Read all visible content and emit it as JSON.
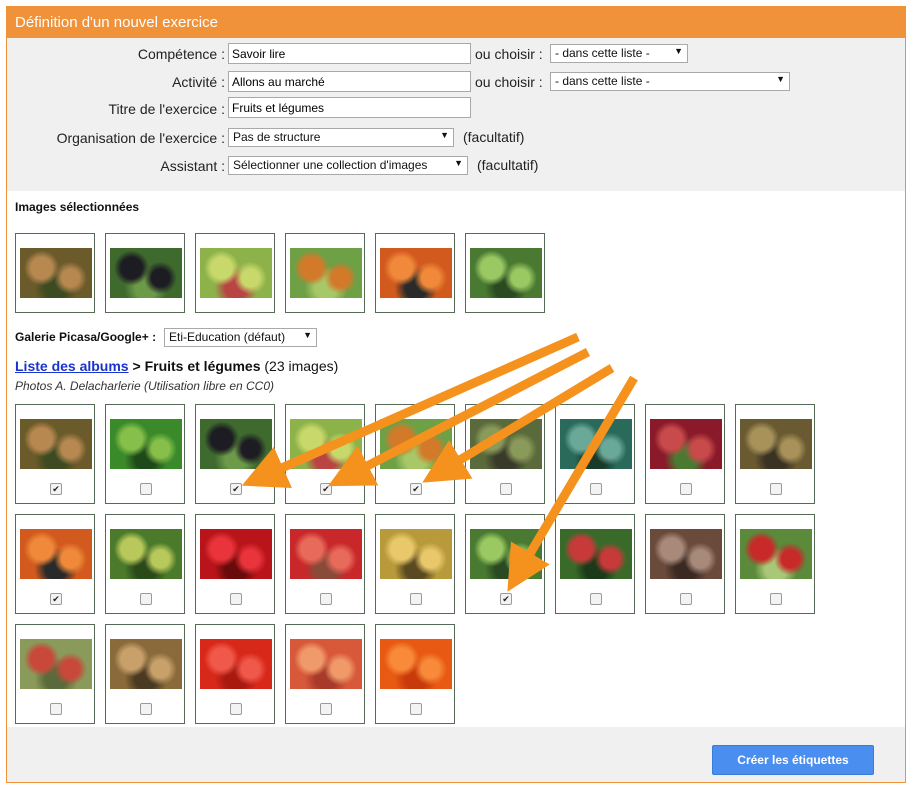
{
  "header": {
    "title": "Définition d'un nouvel exercice"
  },
  "form": {
    "competence": {
      "label": "Compétence :",
      "value": "Savoir lire",
      "or_label": "ou choisir :",
      "select": "- dans cette liste -"
    },
    "activite": {
      "label": "Activité :",
      "value": "Allons au marché",
      "or_label": "ou choisir :",
      "select": "- dans cette liste -"
    },
    "titre": {
      "label": "Titre de l'exercice :",
      "value": "Fruits et légumes"
    },
    "organisation": {
      "label": "Organisation de l'exercice :",
      "select": "Pas de structure",
      "note": "(facultatif)"
    },
    "assistant": {
      "label": "Assistant :",
      "select": "Sélectionner une collection d'images",
      "note": "(facultatif)"
    }
  },
  "selected": {
    "title": "Images sélectionnées",
    "images": [
      {
        "name": "raisins",
        "colors": [
          "#6b5a2a",
          "#b78850",
          "#3d4a22"
        ]
      },
      {
        "name": "mures",
        "colors": [
          "#3e6a2e",
          "#1c1c22",
          "#6c9a48"
        ]
      },
      {
        "name": "raisins-verts",
        "colors": [
          "#8db24a",
          "#c8d86a",
          "#b84444"
        ]
      },
      {
        "name": "tomates-vertes",
        "colors": [
          "#6ea046",
          "#d27a2a",
          "#a8c868"
        ]
      },
      {
        "name": "potiron",
        "colors": [
          "#d25a1e",
          "#f08a3a",
          "#2a2a2a"
        ]
      },
      {
        "name": "salade",
        "colors": [
          "#4a7a32",
          "#9ac862",
          "#2a4a22"
        ]
      }
    ]
  },
  "gallery": {
    "label": "Galerie Picasa/Google+ :",
    "select": "Eti-Education (défaut)"
  },
  "album": {
    "link": "Liste des albums",
    "separator": ">",
    "name": "Fruits et légumes",
    "count": "(23 images)",
    "credit": "Photos A. Delacharlerie (Utilisation libre en CC0)"
  },
  "album_images": [
    {
      "name": "raisins",
      "checked": true,
      "colors": [
        "#6b5a2a",
        "#b78850",
        "#3d4a22"
      ]
    },
    {
      "name": "poivrons",
      "checked": false,
      "colors": [
        "#3a8a2a",
        "#86c04a",
        "#1e4a1a"
      ]
    },
    {
      "name": "mures",
      "checked": true,
      "colors": [
        "#3e6a2e",
        "#1c1c22",
        "#6c9a48"
      ]
    },
    {
      "name": "raisins-verts",
      "checked": true,
      "colors": [
        "#8db24a",
        "#c8d86a",
        "#b84444"
      ]
    },
    {
      "name": "tomates-vertes",
      "checked": true,
      "colors": [
        "#6ea046",
        "#d27a2a",
        "#a8c868"
      ]
    },
    {
      "name": "legumes-jardin",
      "checked": false,
      "colors": [
        "#5a6a3a",
        "#8a9a5a",
        "#3a3a2a"
      ]
    },
    {
      "name": "chou",
      "checked": false,
      "colors": [
        "#2a6a5a",
        "#6aa898",
        "#1a3a2a"
      ]
    },
    {
      "name": "cerises",
      "checked": false,
      "colors": [
        "#8a1a2a",
        "#c84a4a",
        "#4a7a32"
      ]
    },
    {
      "name": "pommes-de-terre",
      "checked": false,
      "colors": [
        "#6a5a32",
        "#a8925a",
        "#3a3222"
      ]
    },
    {
      "name": "potiron",
      "checked": true,
      "colors": [
        "#d25a1e",
        "#f08a3a",
        "#2a2a2a"
      ]
    },
    {
      "name": "poire-arbre",
      "checked": false,
      "colors": [
        "#4a7a2a",
        "#b8c85a",
        "#2a4a1a"
      ]
    },
    {
      "name": "groseilles",
      "checked": false,
      "colors": [
        "#b8141a",
        "#e8343a",
        "#6a0a0a"
      ]
    },
    {
      "name": "fraises",
      "checked": false,
      "colors": [
        "#c8282a",
        "#e86a5a",
        "#8a4a3a"
      ]
    },
    {
      "name": "poires",
      "checked": false,
      "colors": [
        "#b89a3a",
        "#e8c86a",
        "#5a4a22"
      ]
    },
    {
      "name": "salade",
      "checked": true,
      "colors": [
        "#4a7a32",
        "#9ac862",
        "#2a4a22"
      ]
    },
    {
      "name": "groseilles-arbre",
      "checked": false,
      "colors": [
        "#3a6a2a",
        "#c83a3a",
        "#1a3a1a"
      ]
    },
    {
      "name": "noix",
      "checked": false,
      "colors": [
        "#6a4a3a",
        "#a88a7a",
        "#3a2a22"
      ]
    },
    {
      "name": "pomme-rouge",
      "checked": false,
      "colors": [
        "#5a8a3a",
        "#c82a2a",
        "#a8c878"
      ]
    },
    {
      "name": "pommes",
      "checked": false,
      "colors": [
        "#8a9a5a",
        "#c8483a",
        "#5a6a3a"
      ]
    },
    {
      "name": "noix-panier",
      "checked": false,
      "colors": [
        "#8a6a3a",
        "#c8a06a",
        "#4a3a22"
      ]
    },
    {
      "name": "tomates",
      "checked": false,
      "colors": [
        "#d8281a",
        "#f0584a",
        "#a81a10"
      ]
    },
    {
      "name": "peches",
      "checked": false,
      "colors": [
        "#d8583a",
        "#f09a6a",
        "#a83a2a"
      ]
    },
    {
      "name": "oranges",
      "checked": false,
      "colors": [
        "#e85a14",
        "#f88a3a",
        "#c83a0a"
      ]
    }
  ],
  "actions": {
    "create_label": "Créer les étiquettes"
  },
  "colors": {
    "accent": "#f0923a",
    "button": "#4a8ef0",
    "link": "#1a33cc"
  }
}
